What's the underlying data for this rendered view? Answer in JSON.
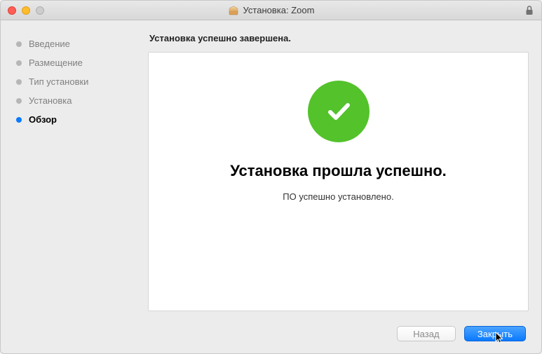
{
  "window": {
    "title": "Установка: Zoom"
  },
  "sidebar": {
    "steps": [
      {
        "label": "Введение"
      },
      {
        "label": "Размещение"
      },
      {
        "label": "Тип установки"
      },
      {
        "label": "Установка"
      },
      {
        "label": "Обзор"
      }
    ]
  },
  "main": {
    "heading": "Установка успешно завершена.",
    "success_title": "Установка прошла успешно.",
    "success_subtitle": "ПО успешно установлено."
  },
  "footer": {
    "back_label": "Назад",
    "close_label": "Закрыть"
  }
}
